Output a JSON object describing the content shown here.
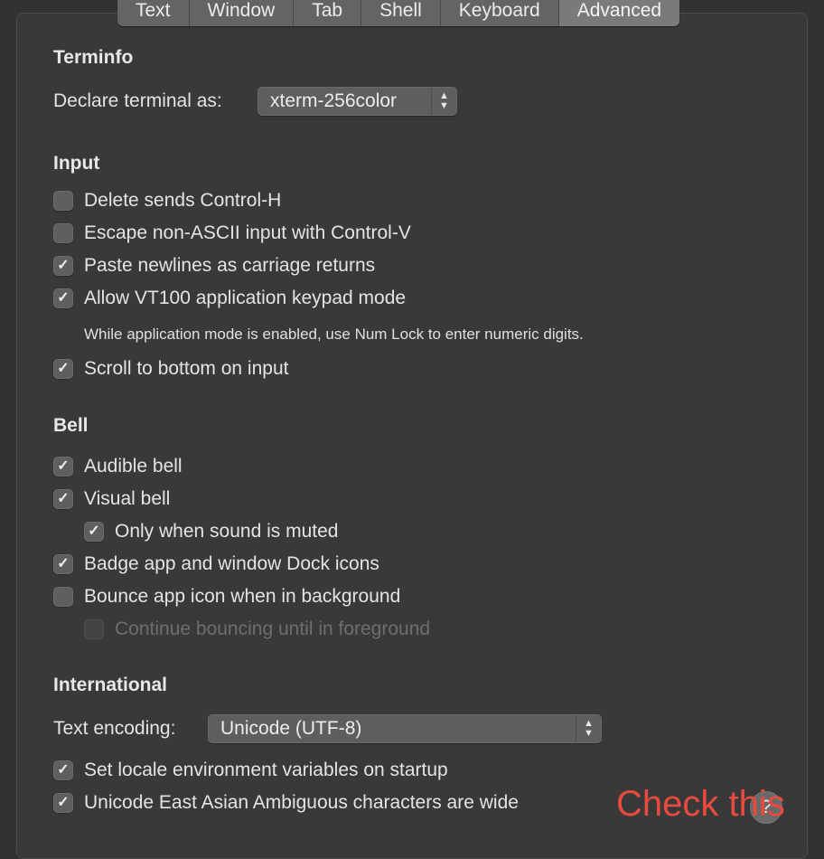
{
  "tabs": [
    {
      "label": "Text",
      "active": false
    },
    {
      "label": "Window",
      "active": false
    },
    {
      "label": "Tab",
      "active": false
    },
    {
      "label": "Shell",
      "active": false
    },
    {
      "label": "Keyboard",
      "active": false
    },
    {
      "label": "Advanced",
      "active": true
    }
  ],
  "terminfo": {
    "title": "Terminfo",
    "declare_label": "Declare terminal as:",
    "declare_value": "xterm-256color"
  },
  "input": {
    "title": "Input",
    "delete_sends": {
      "label": "Delete sends Control-H",
      "checked": false
    },
    "escape_non_ascii": {
      "label": "Escape non-ASCII input with Control-V",
      "checked": false
    },
    "paste_newlines": {
      "label": "Paste newlines as carriage returns",
      "checked": true
    },
    "vt100_keypad": {
      "label": "Allow VT100 application keypad mode",
      "checked": true
    },
    "vt100_note": "While application mode is enabled, use Num Lock to enter numeric digits.",
    "scroll_bottom": {
      "label": "Scroll to bottom on input",
      "checked": true
    }
  },
  "bell": {
    "title": "Bell",
    "audible": {
      "label": "Audible bell",
      "checked": true
    },
    "visual": {
      "label": "Visual bell",
      "checked": true
    },
    "only_muted": {
      "label": "Only when sound is muted",
      "checked": true
    },
    "badge": {
      "label": "Badge app and window Dock icons",
      "checked": true
    },
    "bounce": {
      "label": "Bounce app icon when in background",
      "checked": false
    },
    "continue_bounce": {
      "label": "Continue bouncing until in foreground",
      "checked": false,
      "enabled": false
    }
  },
  "international": {
    "title": "International",
    "encoding_label": "Text encoding:",
    "encoding_value": "Unicode (UTF-8)",
    "set_locale": {
      "label": "Set locale environment variables on startup",
      "checked": true
    },
    "east_asian": {
      "label": "Unicode East Asian Ambiguous characters are wide",
      "checked": true
    }
  },
  "help_button": {
    "label": "?"
  },
  "annotation": {
    "text": "Check this",
    "color": "#e84a3e"
  },
  "icons": {
    "check": "✓",
    "stepper_up": "▲",
    "stepper_down": "▼"
  }
}
